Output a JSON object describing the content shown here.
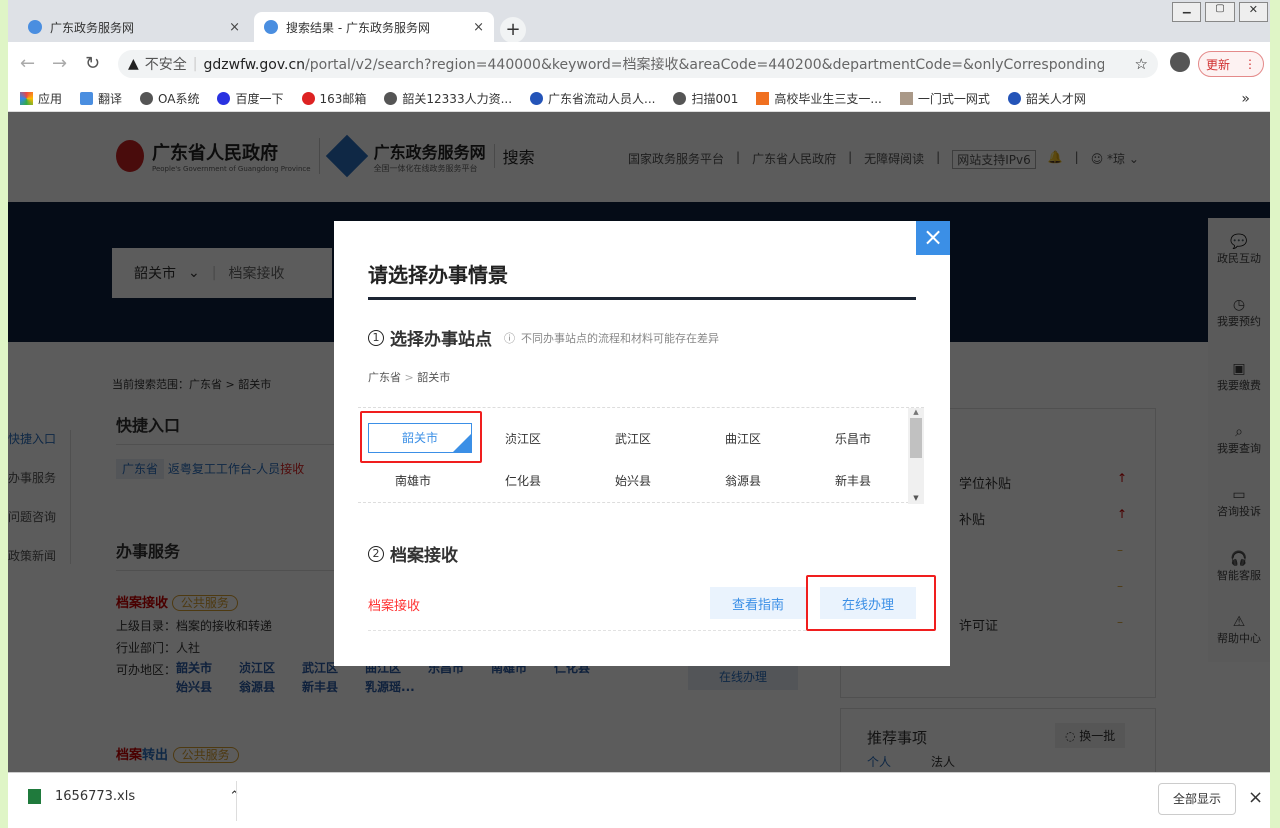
{
  "browser": {
    "tabs": [
      {
        "title": "广东政务服务网",
        "close": "×"
      },
      {
        "title": "搜索结果 - 广东政务服务网",
        "close": "×"
      }
    ],
    "new_tab": "+",
    "security": "不安全",
    "url_host": "gdzwfw.gov.cn",
    "url_path": "/portal/v2/search?region=440000&keyword=档案接收&areaCode=440200&departmentCode=&onlyCorrespondingLeve...",
    "update_button": "更新",
    "bookmarks": [
      "应用",
      "翻译",
      "OA系统",
      "百度一下",
      "163邮箱",
      "韶关12333人力资...",
      "广东省流动人员人...",
      "扫描001",
      "高校毕业生三支一...",
      "一门式一网式",
      "韶关人才网"
    ],
    "more": "»"
  },
  "header": {
    "gov_name": "广东省人民政府",
    "gov_sub": "People's Government of Guangdong Province",
    "site_name": "广东政务服务网",
    "site_sub": "全国一体化在线政务服务平台",
    "search_label": "搜索",
    "nav": [
      "国家政务服务平台",
      "广东省人民政府",
      "无障碍阅读",
      "网站支持IPv6"
    ],
    "user": "*琼"
  },
  "search": {
    "region": "韶关市",
    "keyword": "档案接收"
  },
  "scope": "当前搜索范围：广东省 > 韶关市",
  "side_nav": [
    "快捷入口",
    "办事服务",
    "问题咨询",
    "政策新闻"
  ],
  "quick": {
    "title": "快捷入口",
    "tag": "广东省",
    "link_a": "返粤复工工作台-人员",
    "link_b": "接收"
  },
  "services": {
    "title": "办事服务",
    "item1": {
      "name_a": "档案接收",
      "badge": "公共服务",
      "catalog": "上级目录：档案的接收和转递",
      "dept": "行业部门：人社",
      "area_label": "可办地区：",
      "areas": [
        "韶关市",
        "浈江区",
        "武江区",
        "曲江区",
        "乐昌市",
        "南雄市",
        "仁化县",
        "始兴县",
        "翁源县",
        "新丰县",
        "乳源瑶..."
      ],
      "button": "在线办理"
    },
    "item2": {
      "name_a": "档案",
      "name_b": "转出",
      "badge": "公共服务"
    }
  },
  "right_panel": {
    "items": [
      "学位补贴",
      "补贴",
      "",
      "",
      "许可证"
    ],
    "recommend": "推荐事项",
    "refresh": "换一批",
    "tabs": [
      "个人",
      "法人"
    ]
  },
  "float_bar": [
    "政民互动",
    "我要预约",
    "我要缴费",
    "我要查询",
    "咨询投诉",
    "智能客服",
    "帮助中心"
  ],
  "modal": {
    "title": "请选择办事情景",
    "close": "×",
    "step1": {
      "num": "1",
      "title": "选择办事站点",
      "hint": "不同办事站点的流程和材料可能存在差异",
      "crumb_a": "广东省",
      "crumb_sep": ">",
      "crumb_b": "韶关市",
      "sites": [
        "韶关市",
        "浈江区",
        "武江区",
        "曲江区",
        "乐昌市",
        "南雄市",
        "仁化县",
        "始兴县",
        "翁源县",
        "新丰县"
      ],
      "selected": "韶关市"
    },
    "step2": {
      "num": "2",
      "title": "档案接收",
      "item": "档案接收",
      "guide": "查看指南",
      "online": "在线办理"
    }
  },
  "download": {
    "file": "1656773.xls",
    "show_all": "全部显示",
    "close": "×"
  },
  "colors": {
    "accent": "#3b8fe6",
    "highlight": "#f01e1e",
    "dark_band": "#0d2240"
  }
}
